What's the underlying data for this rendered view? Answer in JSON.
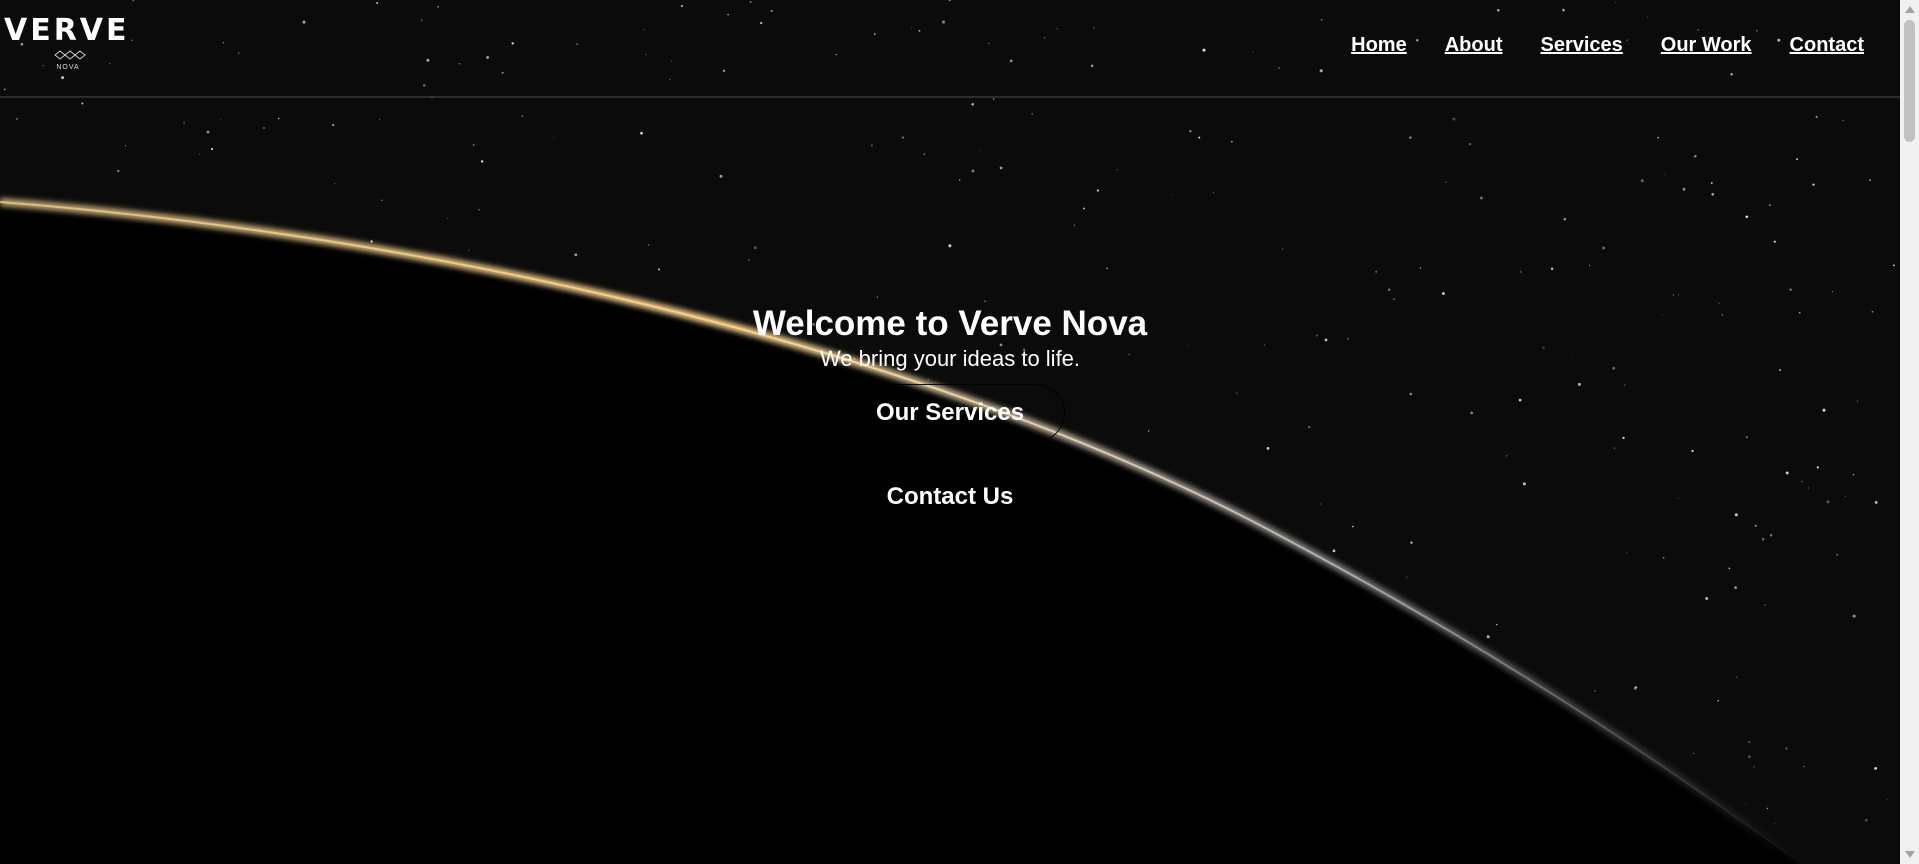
{
  "brand": {
    "name": "VERVE",
    "tagline": "NOVA"
  },
  "nav": {
    "items": [
      "Home",
      "About",
      "Services",
      "Our Work",
      "Contact"
    ]
  },
  "hero": {
    "title": "Welcome to Verve Nova",
    "subtitle": "We bring your ideas to life.",
    "primary_button": "Our Services",
    "secondary_button": "Contact Us"
  },
  "colors": {
    "background": "#000000",
    "text": "#ffffff",
    "horizon_glow": "#f2c06a"
  }
}
